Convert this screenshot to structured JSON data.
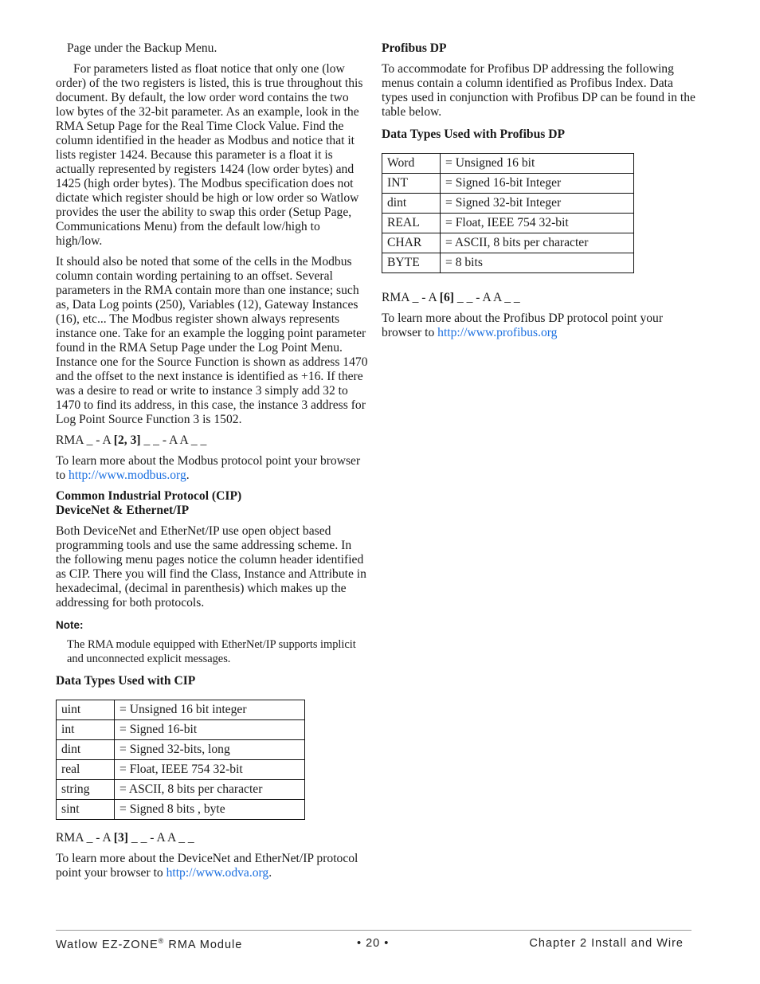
{
  "left_column": {
    "intro_continuation": "Page under the Backup Menu.",
    "float_paragraph": "For parameters listed as float notice that only one (low order) of the two registers is listed, this is true throughout this document. By default, the low order word contains the two low bytes of the 32-bit parameter. As an example, look in the RMA Setup Page for the Real Time Clock Value. Find the column identified in the header as Modbus and notice that it lists register 1424. Because this parameter is a float it is actually represented by registers 1424 (low order bytes) and 1425 (high order bytes). The Modbus specification does not dictate which register should be high or low order so Watlow provides the user the ability to swap this order (Setup Page, Communications Menu) from the default low/high to high/low.",
    "offset_paragraph": "It should also be noted that some of the cells in the Modbus column contain wording pertaining to an offset. Several parameters in the RMA contain more than one instance; such as, Data Log points (250), Variables (12), Gateway Instances (16), etc... The Modbus register shown always represents instance one. Take for an example the logging point parameter found in the RMA Setup Page under the Log Point Menu. Instance one for the Source Function is shown as address 1470 and the offset to the next instance is identified as +16. If there was a desire to read or write to instance 3 simply add 32 to 1470 to find its address, in this case, the instance 3 address for Log Point Source Function 3 is 1502.",
    "modbus_part_number": {
      "prefix": "RMA _ - A ",
      "bold": "[2, 3]",
      "suffix": " _ _ - A A _ _"
    },
    "modbus_learn_more": {
      "text": "To learn more about the Modbus protocol point your browser to ",
      "link": "http://www.modbus.org",
      "trail": "."
    },
    "cip_heading_line1": "Common Industrial Protocol (CIP)",
    "cip_heading_line2": "DeviceNet & Ethernet/IP",
    "cip_paragraph": "Both DeviceNet and EtherNet/IP use open object based programming tools and use the same addressing scheme. In the following menu pages notice the column header identified as CIP. There you will find the Class, Instance and Attribute in hexadecimal, (decimal in parenthesis) which makes up the addressing for both protocols.",
    "note_label": "Note:",
    "note_text": "The RMA module equipped with EtherNet/IP supports implicit and unconnected explicit messages.",
    "cip_table_title": "Data Types Used with CIP",
    "cip_table": [
      {
        "type": "uint",
        "desc": "= Unsigned 16 bit integer"
      },
      {
        "type": "int",
        "desc": "= Signed 16-bit"
      },
      {
        "type": "dint",
        "desc": "= Signed 32-bits, long"
      },
      {
        "type": "real",
        "desc": "= Float, IEEE 754 32-bit"
      },
      {
        "type": "string",
        "desc": "= ASCII, 8 bits per character"
      },
      {
        "type": "sint",
        "desc": "= Signed 8 bits , byte"
      }
    ],
    "cip_part_number": {
      "prefix": "RMA _ - A ",
      "bold": "[3]",
      "suffix": " _ _ - A A _ _"
    },
    "cip_learn_more": {
      "text": "To learn more about the DeviceNet and EtherNet/IP protocol point your browser to ",
      "link": "http://www.odva.org",
      "trail": "."
    }
  },
  "right_column": {
    "profibus_heading": "Profibus DP",
    "profibus_paragraph": "To accommodate for Profibus DP addressing the following menus contain a column identified as Profibus Index. Data types used in conjunction with Profibus DP can be found in the table below.",
    "profibus_table_title": "Data Types Used with Profibus DP",
    "profibus_table": [
      {
        "type": "Word",
        "desc": "= Unsigned 16 bit"
      },
      {
        "type": "INT",
        "desc": "= Signed 16-bit Integer"
      },
      {
        "type": "dint",
        "desc": "= Signed 32-bit Integer"
      },
      {
        "type": "REAL",
        "desc": "= Float, IEEE 754 32-bit"
      },
      {
        "type": "CHAR",
        "desc": "= ASCII, 8 bits per character"
      },
      {
        "type": "BYTE",
        "desc": "= 8 bits"
      }
    ],
    "profibus_part_number": {
      "prefix": "RMA _ - A ",
      "bold": "[6]",
      "suffix": " _ _ - A A _ _"
    },
    "profibus_learn_more": {
      "text": "To learn more about the Profibus DP protocol point your browser to ",
      "link": "http://www.profibus.org",
      "trail": ""
    }
  },
  "footer": {
    "product_name": "Watlow EZ-ZONE",
    "registered_mark": "®",
    "product_suffix": " RMA Module",
    "page_number": "•  20  •",
    "chapter": "Chapter 2 Install and Wire"
  },
  "colors": {
    "link": "#1a6fe0",
    "text": "#1a1a1a",
    "rule": "#9a9a9a"
  }
}
